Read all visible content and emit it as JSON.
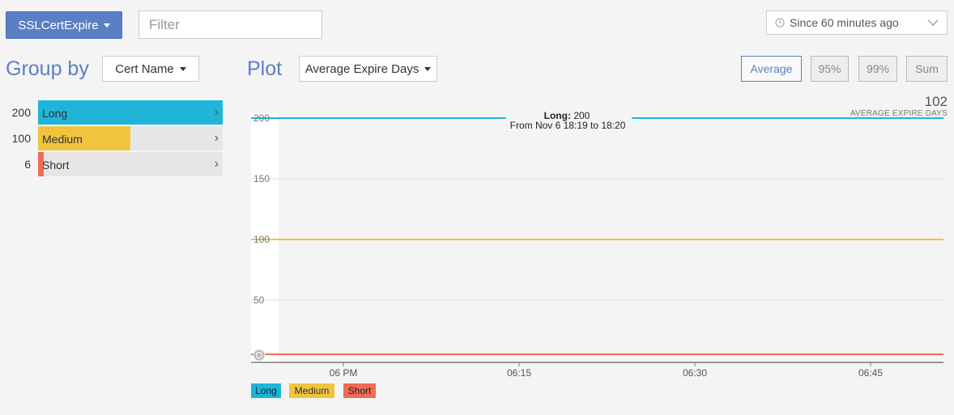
{
  "toolbar": {
    "metric_label": "SSLCertExpire",
    "filter_placeholder": "Filter",
    "time_range_label": "Since 60 minutes ago"
  },
  "group_by": {
    "title": "Group by",
    "selected": "Cert Name",
    "rows": [
      {
        "count": "200",
        "label": "Long",
        "value": 200,
        "color": "#1fb5d9"
      },
      {
        "count": "100",
        "label": "Medium",
        "value": 100,
        "color": "#f0c53d"
      },
      {
        "count": "6",
        "label": "Short",
        "value": 6,
        "color": "#f06c55"
      }
    ]
  },
  "plot": {
    "title": "Plot",
    "selected": "Average Expire Days",
    "aggregations": [
      {
        "label": "Average",
        "active": true
      },
      {
        "label": "95%",
        "active": false
      },
      {
        "label": "99%",
        "active": false
      },
      {
        "label": "Sum",
        "active": false
      }
    ],
    "summary_value": "102",
    "summary_label": "AVERAGE EXPIRE DAYS",
    "tooltip": {
      "series": "Long:",
      "value": "200",
      "range": "From Nov 6 18:19 to 18:20"
    }
  },
  "chart_data": {
    "type": "line",
    "x_ticks": [
      "06 PM",
      "06:15",
      "06:30",
      "06:45"
    ],
    "y_ticks": [
      50,
      100,
      150,
      200
    ],
    "ylim": [
      0,
      210
    ],
    "series": [
      {
        "name": "Long",
        "color": "#1fb5d9",
        "values": [
          200,
          200
        ]
      },
      {
        "name": "Medium",
        "color": "#f0c53d",
        "values": [
          100,
          100
        ]
      },
      {
        "name": "Short",
        "color": "#f06c55",
        "values": [
          6,
          6
        ]
      }
    ]
  }
}
